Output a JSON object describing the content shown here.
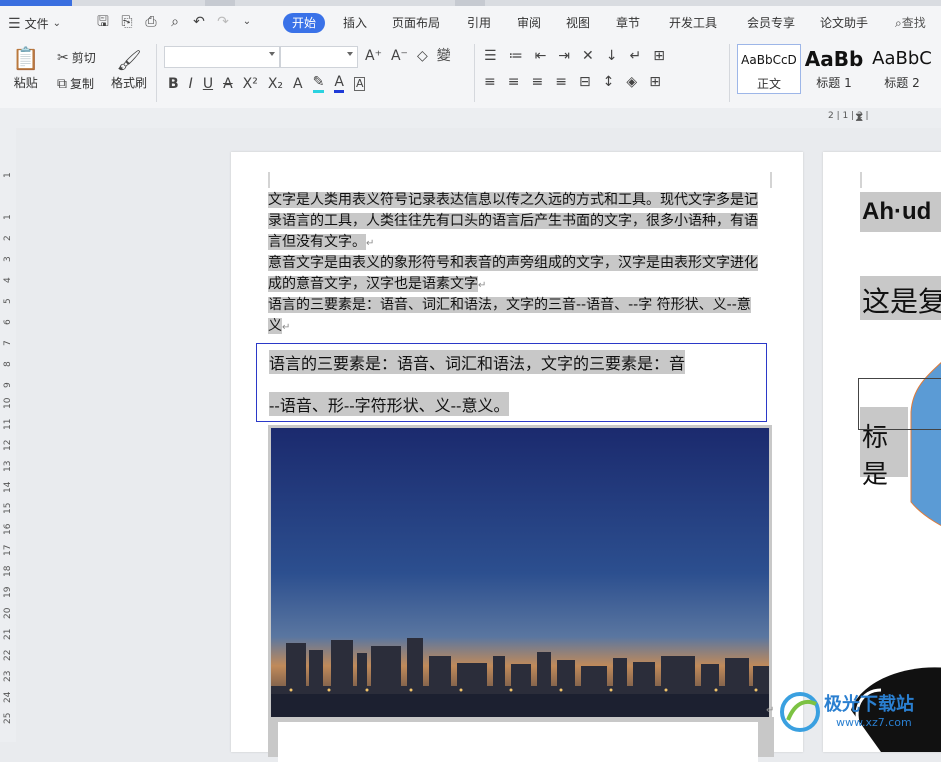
{
  "menu": {
    "file_label": "文件",
    "tabs": [
      "开始",
      "插入",
      "页面布局",
      "引用",
      "审阅",
      "视图",
      "章节",
      "开发工具",
      "会员专享",
      "论文助手"
    ],
    "active_tab": "开始",
    "search_label": "查找"
  },
  "ribbon": {
    "paste_label": "粘贴",
    "cut_label": "剪切",
    "copy_label": "复制",
    "format_painter_label": "格式刷",
    "font_name_value": "",
    "font_size_value": "",
    "styles": [
      {
        "preview": "AaBbCcD",
        "name": "正文"
      },
      {
        "preview": "AaBb",
        "name": "标题 1"
      },
      {
        "preview": "AaBbC",
        "name": "标题 2"
      }
    ]
  },
  "ruler": {
    "h_marks": "2  |  1  |  2  |",
    "v_numbers": [
      "1",
      "1",
      "2",
      "3",
      "4",
      "5",
      "6",
      "7",
      "8",
      "9",
      "10",
      "11",
      "12",
      "13",
      "14",
      "15",
      "16",
      "17",
      "18",
      "19",
      "20",
      "21",
      "22",
      "23",
      "24",
      "25"
    ]
  },
  "page1": {
    "para1": "文字是人类用表义符号记录表达信息以传之久远的方式和工具。现代文字多是记录语言的工具，人类往往先有口头的语言后产生书面的文字，很多小语种，有语言但没有文字。",
    "para2": "意音文字是由表义的象形符号和表音的声旁组成的文字，汉字是由表形文字进化成的意音文字，汉字也是语素文字",
    "para3": "语言的三要素是：语音、词汇和语法，文字的三音--语音、--字 符形状、义--意义",
    "frame_line1": "语言的三要素是：语音、词汇和语法，文字的三要素是：音",
    "frame_line2": "--语音、形--字符形状、义--意义。",
    "return_mark": "↵"
  },
  "page2": {
    "heading1": "Ah·ud",
    "heading2": "这是复",
    "heading3": "标是"
  },
  "watermark": {
    "title": "极光下载站",
    "url": "www.xz7.com"
  },
  "colors": {
    "accent": "#3a72e8",
    "highlight": "#c8c8c8",
    "frame_border": "#2b39c8",
    "shape_fill": "#5b9bd5",
    "shape_stroke": "#e07b39"
  }
}
